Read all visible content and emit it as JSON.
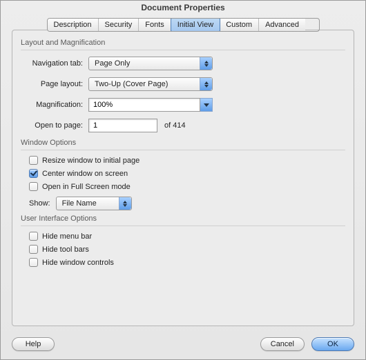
{
  "title": "Document Properties",
  "tabs": [
    "Description",
    "Security",
    "Fonts",
    "Initial View",
    "Custom",
    "Advanced"
  ],
  "active_tab": 3,
  "layout": {
    "header": "Layout and Magnification",
    "nav_label": "Navigation tab:",
    "nav_value": "Page Only",
    "pagelayout_label": "Page layout:",
    "pagelayout_value": "Two-Up (Cover Page)",
    "mag_label": "Magnification:",
    "mag_value": "100%",
    "openpage_label": "Open to page:",
    "openpage_value": "1",
    "of_label": "of 414"
  },
  "window": {
    "header": "Window Options",
    "resize": "Resize window to initial page",
    "center": "Center window on screen",
    "fullscreen": "Open in Full Screen mode",
    "show_label": "Show:",
    "show_value": "File Name",
    "resize_checked": false,
    "center_checked": true,
    "fullscreen_checked": false
  },
  "ui": {
    "header": "User Interface Options",
    "menubar": "Hide menu bar",
    "toolbars": "Hide tool bars",
    "wincontrols": "Hide window controls",
    "menubar_checked": false,
    "toolbars_checked": false,
    "wincontrols_checked": false
  },
  "buttons": {
    "help": "Help",
    "cancel": "Cancel",
    "ok": "OK"
  }
}
